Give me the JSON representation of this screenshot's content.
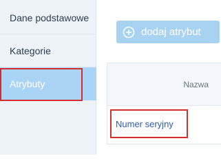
{
  "sidebar": {
    "items": [
      {
        "label": "Dane podstawowe"
      },
      {
        "label": "Kategorie"
      },
      {
        "label": "Atrybuty"
      }
    ]
  },
  "main": {
    "add_button_label": "dodaj atrybut",
    "table": {
      "column_name": "Nazwa",
      "rows": [
        {
          "name": "Numer seryjny"
        }
      ]
    }
  },
  "colors": {
    "active_tab": "#a9d4f5",
    "button": "#a8d2f2",
    "link": "#2a5db0",
    "highlight": "#d32f2f"
  },
  "icons": {
    "add": "plus-circle-icon"
  }
}
